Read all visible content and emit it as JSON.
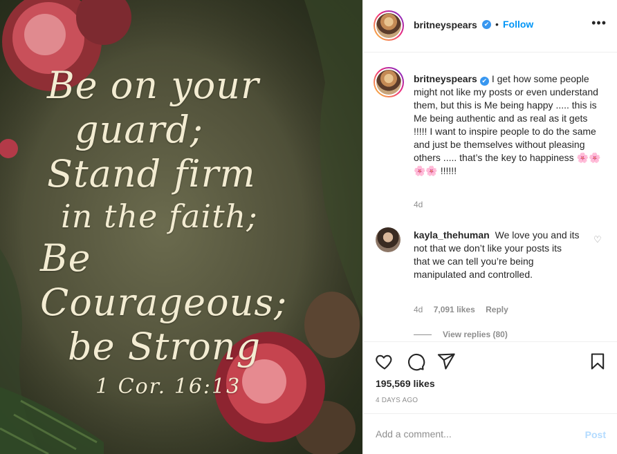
{
  "post": {
    "image_text": {
      "lines": [
        "Be on your",
        "guard;",
        "Stand firm",
        "in the faith;",
        "Be Courageous;",
        "be Strong"
      ],
      "reference": "1 Cor. 16:13"
    }
  },
  "header": {
    "username": "britneyspears",
    "verified_icon": "✔",
    "separator": "•",
    "follow_label": "Follow",
    "more_icon": "•••"
  },
  "caption": {
    "username": "britneyspears",
    "verified_icon": "✔",
    "text": "I get how some people might not like my posts or even understand them, but this is Me being happy ..... this is Me being authentic and as real as it gets !!!!! I want to inspire people to do the same and just be themselves without pleasing others ..... that’s the key to happiness 🌸🌸🌸🌸 !!!!!!",
    "time": "4d"
  },
  "comment": {
    "username": "kayla_thehuman",
    "text": "We love you and its not that we don’t like your posts its that we can tell you’re being manipulated and controlled.",
    "time": "4d",
    "likes": "7,091 likes",
    "reply_label": "Reply",
    "heart_icon": "♡",
    "view_replies": "View replies (80)"
  },
  "actions": {
    "likes_count": "195,569 likes",
    "date": "4 DAYS AGO"
  },
  "add_comment": {
    "placeholder": "Add a comment...",
    "post_label": "Post"
  },
  "colors": {
    "link_blue": "#0095f6",
    "post_disabled": "#b3dbff",
    "muted": "#8e8e8e",
    "verified": "#3897f0"
  }
}
